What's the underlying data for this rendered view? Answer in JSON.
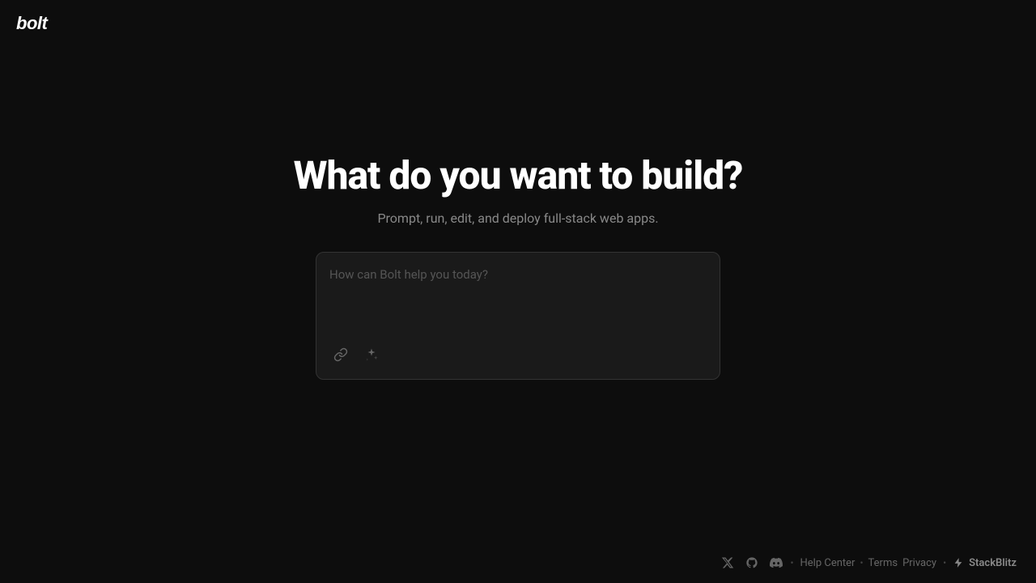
{
  "header": {
    "logo": "bolt"
  },
  "main": {
    "headline": "What do you want to build?",
    "subtitle": "Prompt, run, edit, and deploy full-stack web apps.",
    "input": {
      "placeholder": "How can Bolt help you today?",
      "value": ""
    },
    "toolbar": {
      "link_icon": "link-icon",
      "sparkle_icon": "sparkle-icon"
    }
  },
  "footer": {
    "social": {
      "x_label": "X",
      "github_label": "GitHub",
      "discord_label": "Discord"
    },
    "links": [
      {
        "label": "Help Center",
        "id": "help-center"
      },
      {
        "label": "Terms",
        "id": "terms"
      },
      {
        "label": "Privacy",
        "id": "privacy"
      }
    ],
    "brand": "StackBlitz"
  }
}
